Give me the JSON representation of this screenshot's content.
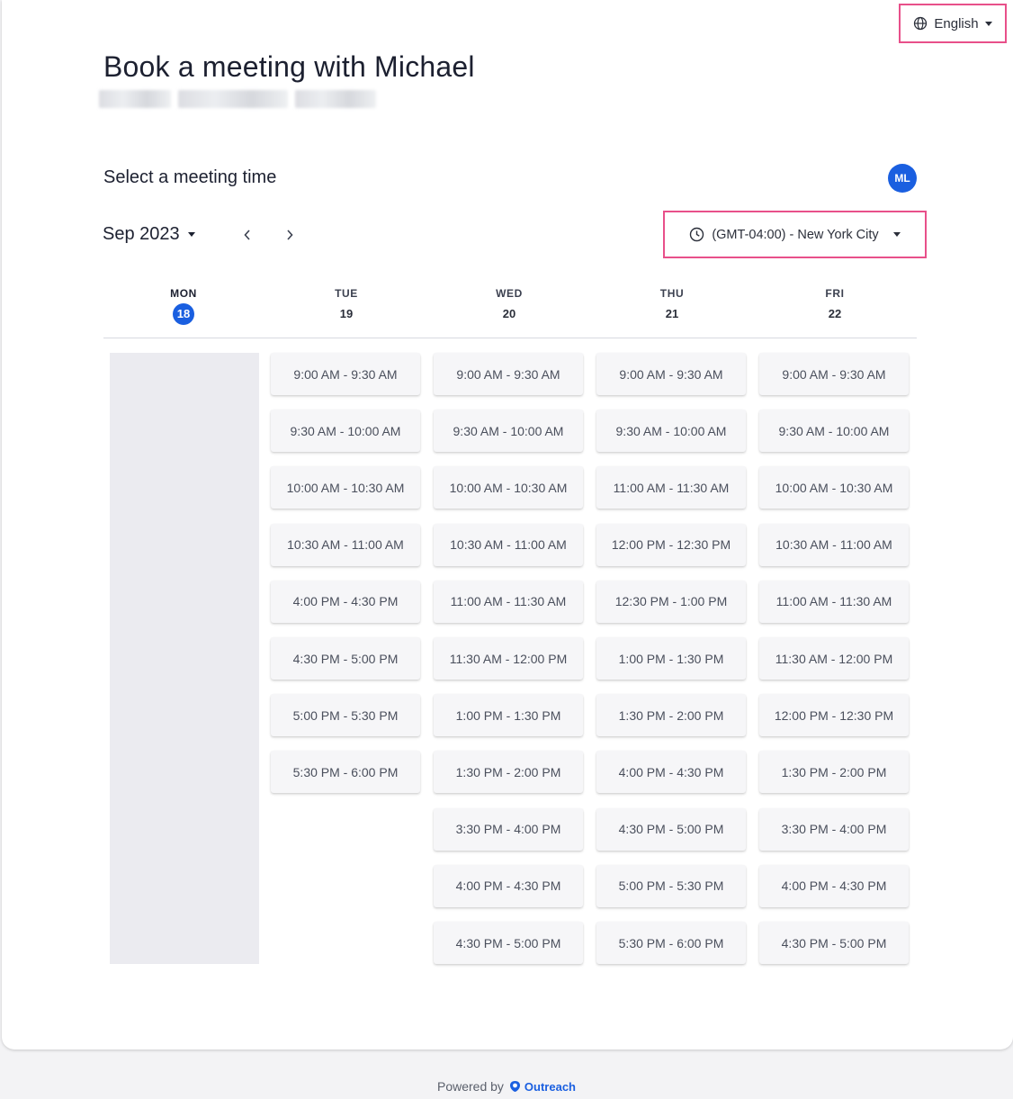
{
  "header": {
    "language": "English",
    "title": "Book a meeting with Michael"
  },
  "scheduler": {
    "section_title": "Select a meeting time",
    "avatar_initials": "ML",
    "month_label": "Sep 2023",
    "prev_label": "‹",
    "next_label": "›",
    "timezone": "(GMT-04:00) - New York City"
  },
  "days": [
    {
      "name": "MON",
      "num": "18",
      "today": true,
      "slots": []
    },
    {
      "name": "TUE",
      "num": "19",
      "today": false,
      "slots": [
        "9:00 AM - 9:30 AM",
        "9:30 AM - 10:00 AM",
        "10:00 AM - 10:30 AM",
        "10:30 AM - 11:00 AM",
        "4:00 PM - 4:30 PM",
        "4:30 PM - 5:00 PM",
        "5:00 PM - 5:30 PM",
        "5:30 PM - 6:00 PM"
      ]
    },
    {
      "name": "WED",
      "num": "20",
      "today": false,
      "slots": [
        "9:00 AM - 9:30 AM",
        "9:30 AM - 10:00 AM",
        "10:00 AM - 10:30 AM",
        "10:30 AM - 11:00 AM",
        "11:00 AM - 11:30 AM",
        "11:30 AM - 12:00 PM",
        "1:00 PM - 1:30 PM",
        "1:30 PM - 2:00 PM",
        "3:30 PM - 4:00 PM",
        "4:00 PM - 4:30 PM",
        "4:30 PM - 5:00 PM"
      ]
    },
    {
      "name": "THU",
      "num": "21",
      "today": false,
      "slots": [
        "9:00 AM - 9:30 AM",
        "9:30 AM - 10:00 AM",
        "11:00 AM - 11:30 AM",
        "12:00 PM - 12:30 PM",
        "12:30 PM - 1:00 PM",
        "1:00 PM - 1:30 PM",
        "1:30 PM - 2:00 PM",
        "4:00 PM - 4:30 PM",
        "4:30 PM - 5:00 PM",
        "5:00 PM - 5:30 PM",
        "5:30 PM - 6:00 PM"
      ]
    },
    {
      "name": "FRI",
      "num": "22",
      "today": false,
      "slots": [
        "9:00 AM - 9:30 AM",
        "9:30 AM - 10:00 AM",
        "10:00 AM - 10:30 AM",
        "10:30 AM - 11:00 AM",
        "11:00 AM - 11:30 AM",
        "11:30 AM - 12:00 PM",
        "12:00 PM - 12:30 PM",
        "1:30 PM - 2:00 PM",
        "3:30 PM - 4:00 PM",
        "4:00 PM - 4:30 PM",
        "4:30 PM - 5:00 PM"
      ]
    }
  ],
  "footer": {
    "powered_by": "Powered by",
    "brand": "Outreach"
  },
  "colors": {
    "accent": "#1a5fe0",
    "highlight_border": "#e8508a"
  }
}
